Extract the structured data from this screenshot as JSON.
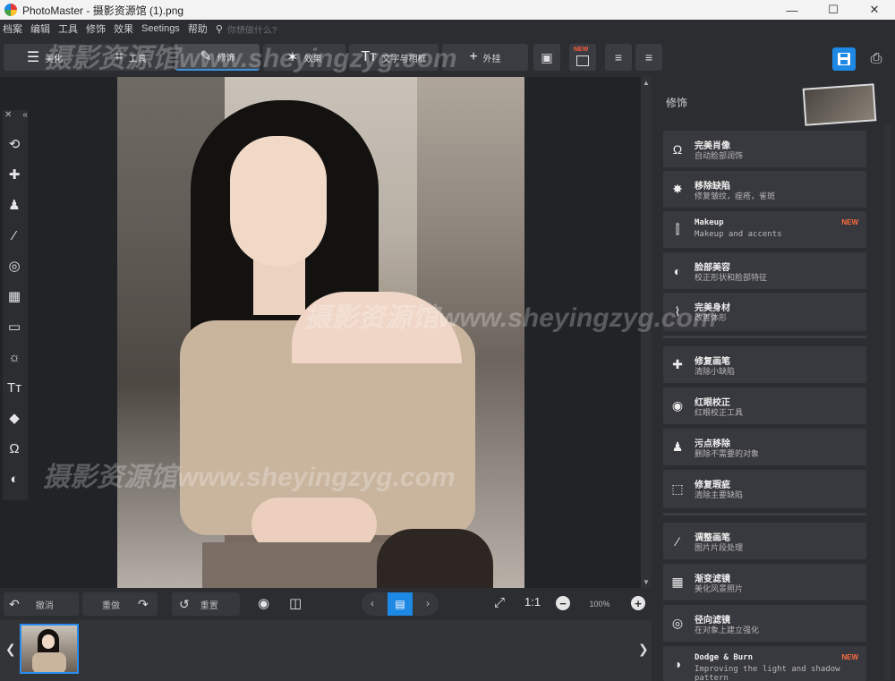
{
  "window": {
    "title": "PhotoMaster - 摄影资源馆 (1).png",
    "minimize": "—",
    "maximize": "☐",
    "close": "✕"
  },
  "menu": {
    "items": [
      "档案",
      "编辑",
      "工具",
      "修饰",
      "效果",
      "Seetings",
      "帮助"
    ],
    "search_placeholder": "你想做什么?"
  },
  "toolbar": {
    "tabs": [
      {
        "label": "美化",
        "icon": "sliders-icon",
        "glyph": "☰"
      },
      {
        "label": "工具",
        "icon": "crop-icon",
        "glyph": "⌗"
      },
      {
        "label": "修饰",
        "icon": "brush-icon",
        "glyph": "✎"
      },
      {
        "label": "效果",
        "icon": "magic-wand-icon",
        "glyph": "✶"
      },
      {
        "label": "文字与相框",
        "icon": "text-icon",
        "glyph": "Tт"
      },
      {
        "label": "外挂",
        "icon": "plus-icon",
        "glyph": "+"
      }
    ],
    "active_tab": 2,
    "new_badge": "NEW"
  },
  "left_tools": [
    {
      "name": "rotate-tool-icon",
      "glyph": "⟲"
    },
    {
      "name": "healing-tool-icon",
      "glyph": "✚"
    },
    {
      "name": "stamp-tool-icon",
      "glyph": "♟"
    },
    {
      "name": "brush-tool-icon",
      "glyph": "⁄"
    },
    {
      "name": "radial-tool-icon",
      "glyph": "◎"
    },
    {
      "name": "gradient-tool-icon",
      "glyph": "▦"
    },
    {
      "name": "vignette-tool-icon",
      "glyph": "▭"
    },
    {
      "name": "light-tool-icon",
      "glyph": "☼"
    },
    {
      "name": "text-tool-icon",
      "glyph": "Tт"
    },
    {
      "name": "fill-tool-icon",
      "glyph": "◆"
    },
    {
      "name": "portrait-tool-icon",
      "glyph": "Ω"
    },
    {
      "name": "face-tool-icon",
      "glyph": "◐"
    }
  ],
  "panel": {
    "title": "修饰",
    "items": [
      {
        "name": "完美肖像",
        "desc": "自动脸部润饰",
        "icon": "portrait-icon",
        "glyph": "Ω",
        "mono": false
      },
      {
        "name": "移除缺陷",
        "desc": "修复皱纹，痤疮，雀斑",
        "icon": "blemish-icon",
        "glyph": "✸",
        "mono": false
      },
      {
        "name": "Makeup",
        "desc": "Makeup and accents",
        "icon": "makeup-icon",
        "glyph": "⫿",
        "mono": true,
        "badge": "NEW"
      },
      {
        "name": "脸部美容",
        "desc": "校正形状和脸部特征",
        "icon": "face-sculpt-icon",
        "glyph": "◐",
        "mono": false
      },
      {
        "name": "完美身材",
        "desc": "改善体形",
        "icon": "body-icon",
        "glyph": "⌇",
        "mono": false
      },
      {
        "name": "修复画笔",
        "desc": "清除小缺陷",
        "icon": "healing-brush-icon",
        "glyph": "✚",
        "mono": false
      },
      {
        "name": "红眼校正",
        "desc": "红眼校正工具",
        "icon": "eye-icon",
        "glyph": "◉",
        "mono": false
      },
      {
        "name": "污点移除",
        "desc": "删除不需要的对象",
        "icon": "stamp-icon",
        "glyph": "♟",
        "mono": false
      },
      {
        "name": "修复瑕疵",
        "desc": "清除主要缺陷",
        "icon": "patch-icon",
        "glyph": "⬚",
        "mono": false
      },
      {
        "name": "调整画笔",
        "desc": "图片片段处理",
        "icon": "adjust-brush-icon",
        "glyph": "⁄",
        "mono": false
      },
      {
        "name": "渐变滤镜",
        "desc": "美化风景照片",
        "icon": "gradient-filter-icon",
        "glyph": "▦",
        "mono": false
      },
      {
        "name": "径向滤镜",
        "desc": "在对象上建立强化",
        "icon": "radial-filter-icon",
        "glyph": "◎",
        "mono": false
      },
      {
        "name": "Dodge & Burn",
        "desc": "Improving the light and shadow pattern",
        "icon": "dodge-burn-icon",
        "glyph": "◑",
        "mono": true,
        "badge": "NEW"
      }
    ]
  },
  "bottom": {
    "undo": "撤消",
    "redo": "重做",
    "reset": "重置",
    "ratio": "1:1",
    "zoom": "100%"
  },
  "watermark": {
    "line1": "摄影资源馆www.sheyingzyg.com",
    "line2": "摄影资源馆www.sheyingzyg.com",
    "line3": "摄影资源馆www.sheyingzyg.com"
  }
}
